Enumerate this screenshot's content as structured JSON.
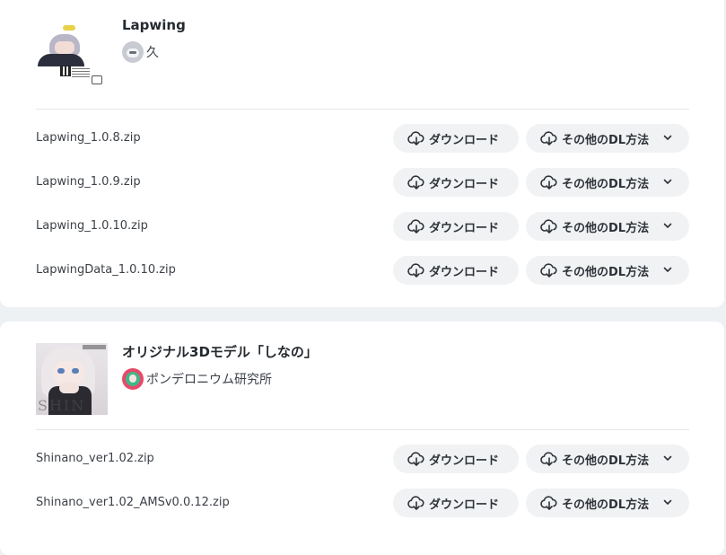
{
  "products": [
    {
      "title": "Lapwing",
      "shop": "久",
      "files": [
        {
          "name": "Lapwing_1.0.8.zip"
        },
        {
          "name": "Lapwing_1.0.9.zip"
        },
        {
          "name": "Lapwing_1.0.10.zip"
        },
        {
          "name": "LapwingData_1.0.10.zip"
        }
      ]
    },
    {
      "title": "オリジナル3Dモデル「しなの」",
      "shop": "ポンデロニウム研究所",
      "files": [
        {
          "name": "Shinano_ver1.02.zip"
        },
        {
          "name": "Shinano_ver1.02_AMSv0.0.12.zip"
        }
      ]
    }
  ],
  "labels": {
    "download": "ダウンロード",
    "other_methods": "その他のDL方法"
  },
  "icons": {
    "download": "cloud-download-icon",
    "chevron": "chevron-down-icon"
  },
  "colors": {
    "page_bg": "#eef1f4",
    "card_bg": "#ffffff",
    "button_bg": "#f1f2f4",
    "text": "#252a2f"
  }
}
